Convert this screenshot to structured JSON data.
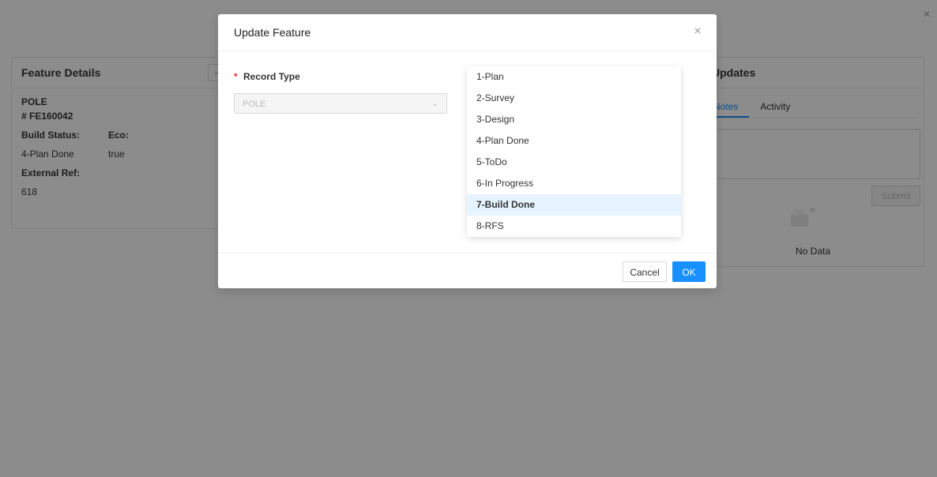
{
  "background": {
    "feature_details": {
      "title": "Feature Details",
      "type": "POLE",
      "id": "# FE160042",
      "build_status_label": "Build Status:",
      "eco_label": "Eco:",
      "build_status_value": "4-Plan Done",
      "eco_value": "true",
      "external_ref_label": "External Ref:",
      "external_ref_value": "618"
    },
    "updates": {
      "title": "Updates",
      "tabs": [
        "Notes",
        "Activity"
      ],
      "submit_label": "Submit",
      "empty_text": "No Data"
    }
  },
  "modal": {
    "title": "Update Feature",
    "field_label": "Record Type",
    "required_mark": "*",
    "record_type_value": "POLE",
    "options": [
      "1-Plan",
      "2-Survey",
      "3-Design",
      "4-Plan Done",
      "5-ToDo",
      "6-In Progress",
      "7-Build Done",
      "8-RFS"
    ],
    "selected_option": "7-Build Done",
    "cancel_label": "Cancel",
    "ok_label": "OK"
  },
  "colors": {
    "primary": "#1890ff",
    "selected_bg": "#e6f4ff",
    "required": "#f5222d"
  }
}
